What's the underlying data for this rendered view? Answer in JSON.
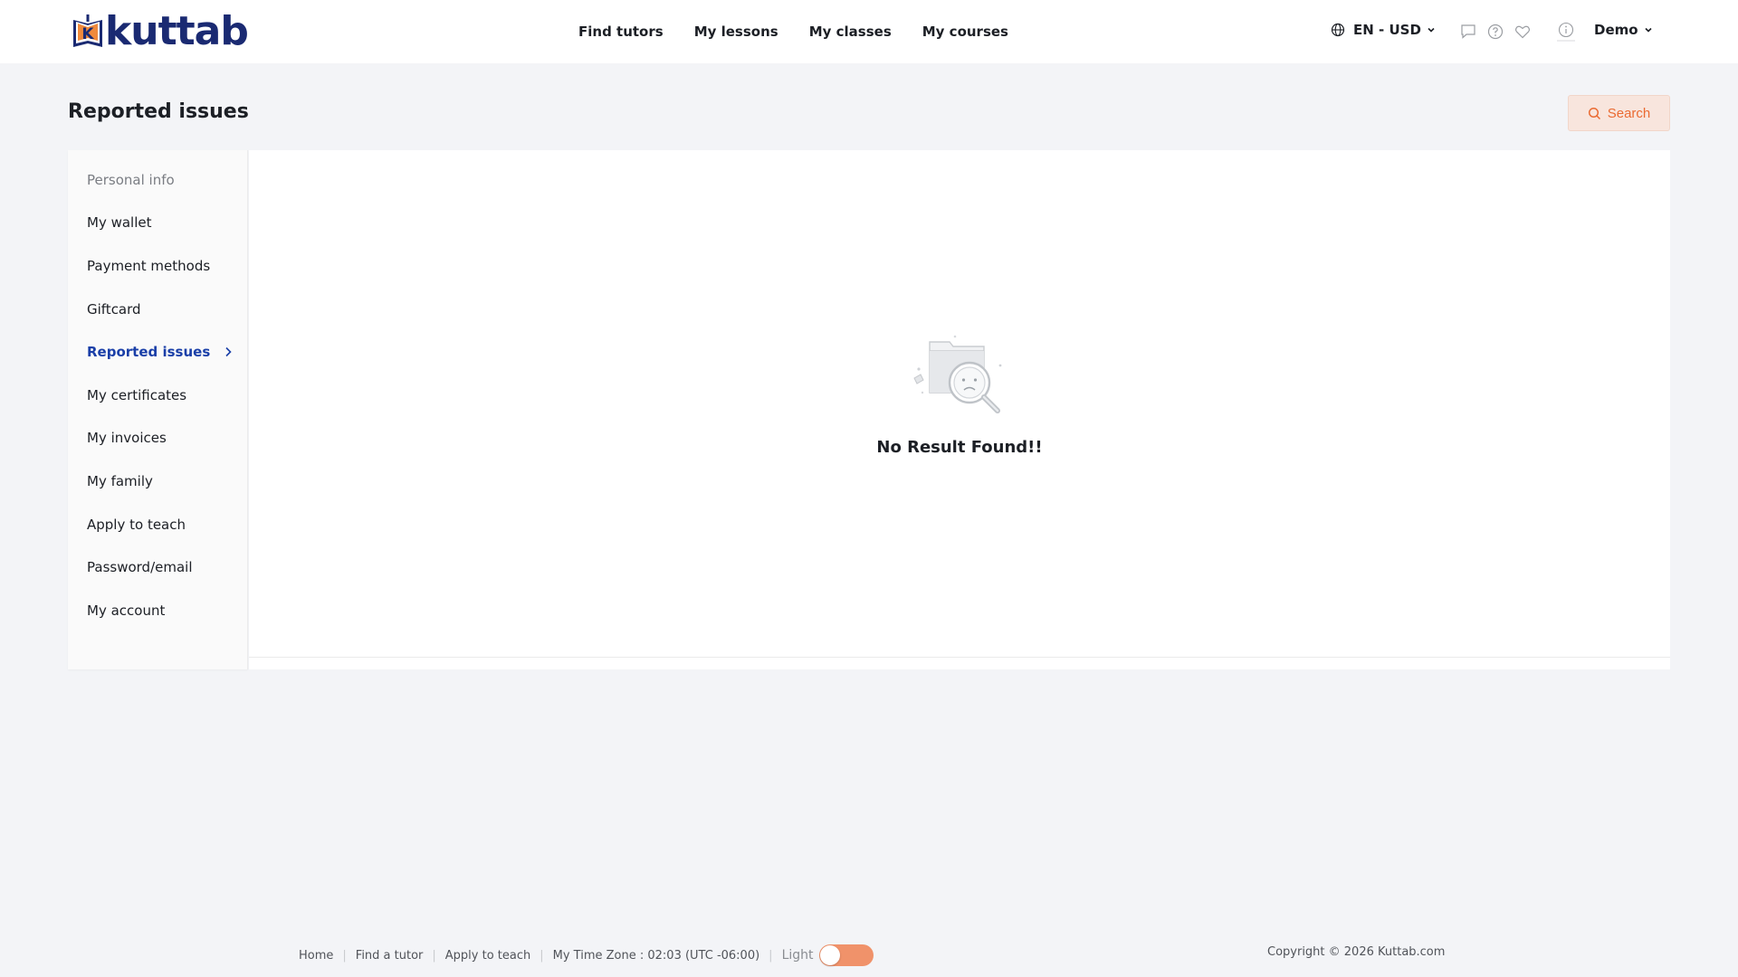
{
  "brand": {
    "logo_text": "kuttab",
    "logo_letter": "K",
    "colors": {
      "navy": "#1a2a72",
      "accent": "#ea6a31",
      "active": "#1a3fa8"
    }
  },
  "nav": {
    "items": [
      "Find tutors",
      "My lessons",
      "My classes",
      "My courses"
    ]
  },
  "header": {
    "lang_currency": "EN - USD",
    "user_name": "Demo",
    "icons": [
      "globe-icon",
      "chat-icon",
      "help-icon",
      "heart-icon",
      "info-icon"
    ]
  },
  "page": {
    "title": "Reported issues",
    "search_label": "Search"
  },
  "sidebar": {
    "items": [
      {
        "label": "Personal info",
        "state": "muted"
      },
      {
        "label": "My wallet",
        "state": "normal"
      },
      {
        "label": "Payment methods",
        "state": "normal"
      },
      {
        "label": "Giftcard",
        "state": "normal"
      },
      {
        "label": "Reported issues",
        "state": "active"
      },
      {
        "label": "My certificates",
        "state": "normal"
      },
      {
        "label": "My invoices",
        "state": "normal"
      },
      {
        "label": "My family",
        "state": "normal"
      },
      {
        "label": "Apply to teach",
        "state": "normal"
      },
      {
        "label": "Password/email",
        "state": "normal"
      },
      {
        "label": "My account",
        "state": "normal"
      }
    ]
  },
  "content": {
    "empty_message": "No Result Found!!"
  },
  "footer": {
    "links": [
      "Home",
      "Find a tutor",
      "Apply to teach"
    ],
    "timezone": "My Time Zone : 02:03 (UTC -06:00)",
    "theme_label": "Light",
    "copyright": "Copyright © 2026 Kuttab.com"
  }
}
